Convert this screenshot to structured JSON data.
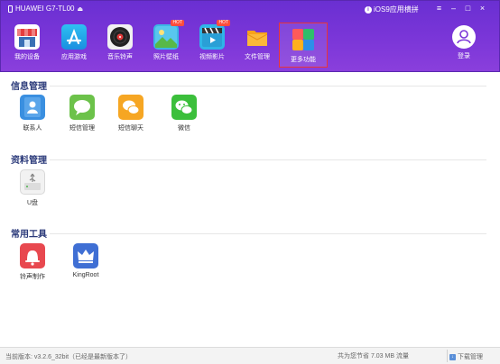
{
  "window": {
    "device_name": "HUAWEI G7-TL00",
    "ios_link": "iOS9应用横拼",
    "minimize": "–",
    "maximize": "□",
    "close": "×",
    "menu": "≡"
  },
  "nav": [
    {
      "label": "我的设备",
      "icon": "store-icon",
      "color": "#e63d3d"
    },
    {
      "label": "应用游戏",
      "icon": "app-store-icon",
      "color": "#19a4e6"
    },
    {
      "label": "音乐铃声",
      "icon": "music-disc-icon",
      "color": "#2b2b2b"
    },
    {
      "label": "照片壁纸",
      "icon": "photo-icon",
      "color": "#3cb6e5",
      "badge": "HOT"
    },
    {
      "label": "视频影片",
      "icon": "clapperboard-icon",
      "color": "#2fb5e8",
      "badge": "HOT"
    },
    {
      "label": "文件管理",
      "icon": "folder-icon",
      "color": "#f7a21b"
    },
    {
      "label": "更多功能",
      "icon": "tiles-icon",
      "color": "#ffffff"
    }
  ],
  "login": {
    "label": "登录"
  },
  "sections": {
    "info": "信息管理",
    "files": "资料管理",
    "tools": "常用工具"
  },
  "info_tools": [
    {
      "label": "联系人",
      "color": "#3a8fe0"
    },
    {
      "label": "短信管理",
      "color": "#6cc24a"
    },
    {
      "label": "短信聊天",
      "color": "#f6a623"
    },
    {
      "label": "微信",
      "color": "#3bbf3b"
    }
  ],
  "file_tools": [
    {
      "label": "U盘",
      "color": "#f2f2f2"
    }
  ],
  "common_tools": [
    {
      "label": "铃声制作",
      "color": "#e8484f"
    },
    {
      "label": "KingRoot",
      "color": "#3f6fd4"
    }
  ],
  "status": {
    "version": "当前版本: v3.2.6_32bit（已经是最新版本了）",
    "saved": "共为您节省  7.03 MB 流量",
    "downloads": "下载管理"
  }
}
